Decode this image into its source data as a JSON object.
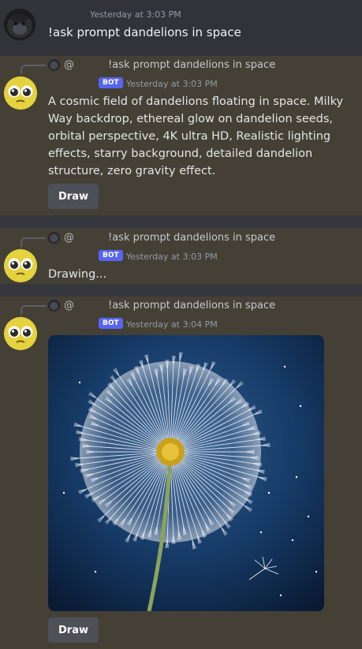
{
  "user_message": {
    "timestamp": "Yesterday at 3:03 PM",
    "text": "!ask prompt dandelions in space"
  },
  "bot_messages": [
    {
      "reply": {
        "at": "@",
        "text": "!ask prompt dandelions in space"
      },
      "badge": "BOT",
      "timestamp": "Yesterday at 3:03 PM",
      "text": "A cosmic field of dandelions floating in space. Milky Way backdrop, ethereal glow on dandelion seeds, orbital perspective, 4K ultra HD, Realistic lighting effects, starry background, detailed dandelion structure, zero gravity effect.",
      "button": "Draw"
    },
    {
      "reply": {
        "at": "@",
        "text": "!ask prompt dandelions in space"
      },
      "badge": "BOT",
      "timestamp": "Yesterday at 3:03 PM",
      "text": "Drawing..."
    },
    {
      "reply": {
        "at": "@",
        "text": "!ask prompt dandelions in space"
      },
      "badge": "BOT",
      "timestamp": "Yesterday at 3:04 PM",
      "button": "Draw"
    }
  ],
  "colors": {
    "bot_badge": "#5865f2",
    "button_bg": "#4e5058",
    "message_bg": "#454035",
    "user_bg": "#323339"
  }
}
